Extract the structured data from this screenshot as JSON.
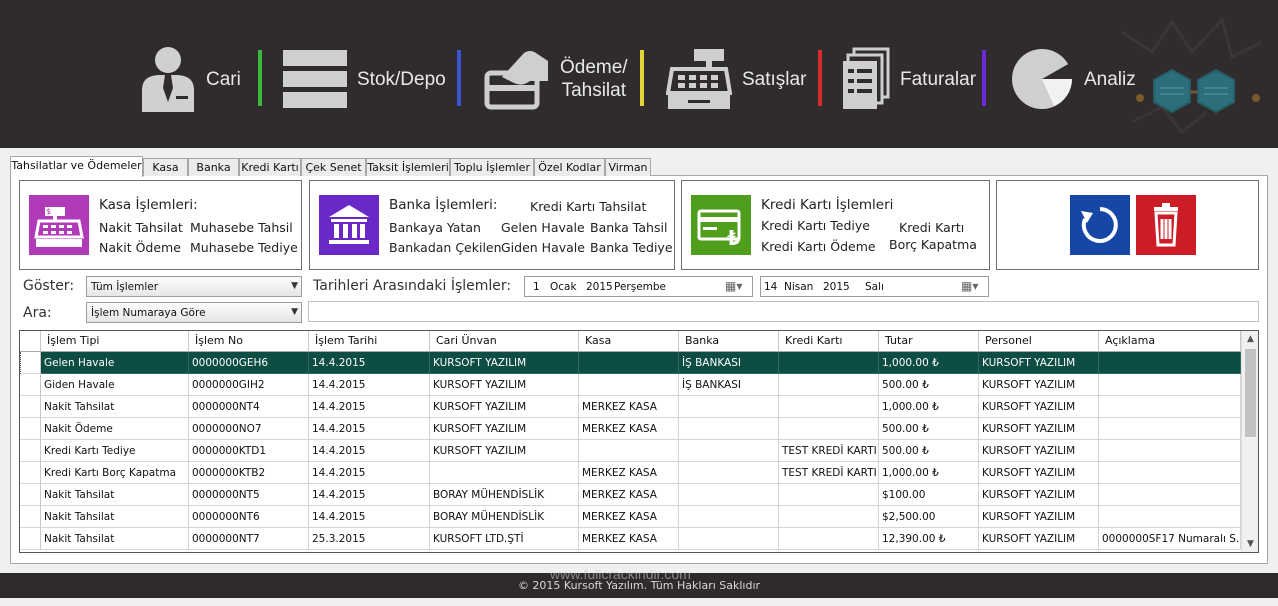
{
  "menu": {
    "items": [
      {
        "label": "Cari"
      },
      {
        "label": "Stok/Depo"
      },
      {
        "label_line1": "Ödeme/",
        "label_line2": "Tahsilat"
      },
      {
        "label": "Satışlar"
      },
      {
        "label": "Faturalar"
      },
      {
        "label": "Analiz"
      }
    ],
    "separator_colors": [
      "#3cb83c",
      "#3a56d4",
      "#e2d43a",
      "#d62b2b",
      "#6a2bd6"
    ]
  },
  "tabs": [
    "Tahsilatlar ve Ödemeler",
    "Kasa",
    "Banka",
    "Kredi Kartı",
    "Çek Senet",
    "Taksit İşlemleri",
    "Toplu İşlemler",
    "Özel Kodlar",
    "Virman"
  ],
  "kasa": {
    "title": "Kasa İşlemleri:",
    "links": [
      "Nakit Tahsilat",
      "Muhasebe Tahsil",
      "Nakit Ödeme",
      "Muhasebe Tediye"
    ],
    "icon_color": "#b03ab7"
  },
  "banka": {
    "title": "Banka İşlemleri:",
    "links": [
      "Kredi Kartı Tahsilat",
      "Bankaya Yatan",
      "Gelen Havale",
      "Banka Tahsil",
      "Bankadan Çekilen",
      "Giden Havale",
      "Banka Tediye"
    ],
    "icon_color": "#6a28c9"
  },
  "kredi": {
    "title": "Kredi Kartı İşlemleri",
    "links": [
      "Kredi Kartı Tediye",
      "Kredi Kartı Ödeme",
      "Kredi Kartı",
      "Borç Kapatma"
    ],
    "icon_color": "#4f9e1c"
  },
  "actions": {
    "refresh_color": "#1747a6",
    "delete_color": "#cc1c25"
  },
  "filters": {
    "goster_label": "Göster:",
    "goster_value": "Tüm İşlemler",
    "ara_label": "Ara:",
    "ara_value": "İşlem Numaraya Göre",
    "tarih_label": "Tarihleri Arasındaki İşlemler:",
    "date_from": {
      "day": "1",
      "month": "Ocak",
      "year": "2015",
      "weekday": "Perşembe"
    },
    "date_to": {
      "day": "14",
      "month": "Nisan",
      "year": "2015",
      "weekday": "Salı"
    }
  },
  "grid": {
    "columns": [
      "İşlem Tipi",
      "İşlem No",
      "İşlem Tarihi",
      "Cari Ünvan",
      "Kasa",
      "Banka",
      "Kredi Kartı",
      "Tutar",
      "Personel",
      "Açıklama"
    ],
    "selected_row": 0,
    "rows": [
      [
        "Gelen Havale",
        "0000000GEH6",
        "14.4.2015",
        "KURSOFT YAZILIM",
        "",
        "İŞ BANKASI",
        "",
        "1,000.00 ₺",
        "KURSOFT YAZILIM",
        ""
      ],
      [
        "Giden Havale",
        "0000000GIH2",
        "14.4.2015",
        "KURSOFT YAZILIM",
        "",
        "İŞ BANKASI",
        "",
        "500.00 ₺",
        "KURSOFT YAZILIM",
        ""
      ],
      [
        "Nakit Tahsilat",
        "0000000NT4",
        "14.4.2015",
        "KURSOFT YAZILIM",
        "MERKEZ KASA",
        "",
        "",
        "1,000.00 ₺",
        "KURSOFT YAZILIM",
        ""
      ],
      [
        "Nakit Ödeme",
        "0000000NO7",
        "14.4.2015",
        "KURSOFT YAZILIM",
        "MERKEZ KASA",
        "",
        "",
        "500.00 ₺",
        "KURSOFT YAZILIM",
        ""
      ],
      [
        "Kredi Kartı Tediye",
        "0000000KTD1",
        "14.4.2015",
        "KURSOFT YAZILIM",
        "",
        "",
        "TEST KREDİ KARTI",
        "500.00 ₺",
        "KURSOFT YAZILIM",
        ""
      ],
      [
        "Kredi Kartı Borç Kapatma",
        "0000000KTB2",
        "14.4.2015",
        "",
        "MERKEZ KASA",
        "",
        "TEST KREDİ KARTI",
        "1,000.00 ₺",
        "KURSOFT YAZILIM",
        ""
      ],
      [
        "Nakit Tahsilat",
        "0000000NT5",
        "14.4.2015",
        "BORAY MÜHENDİSLİK",
        "MERKEZ KASA",
        "",
        "",
        "$100.00",
        "KURSOFT YAZILIM",
        ""
      ],
      [
        "Nakit Tahsilat",
        "0000000NT6",
        "14.4.2015",
        "BORAY MÜHENDİSLİK",
        "MERKEZ KASA",
        "",
        "",
        "$2,500.00",
        "KURSOFT YAZILIM",
        ""
      ],
      [
        "Nakit Tahsilat",
        "0000000NT7",
        "25.3.2015",
        "KURSOFT LTD.ŞTİ",
        "MERKEZ KASA",
        "",
        "",
        "12,390.00 ₺",
        "KURSOFT YAZILIM",
        "0000000SF17 Numaralı S..."
      ]
    ]
  },
  "footer": {
    "copyright": "© 2015 Kursoft Yazılım. Tüm Hakları Saklıdır",
    "watermark": "www.fullcrackindir.com"
  }
}
